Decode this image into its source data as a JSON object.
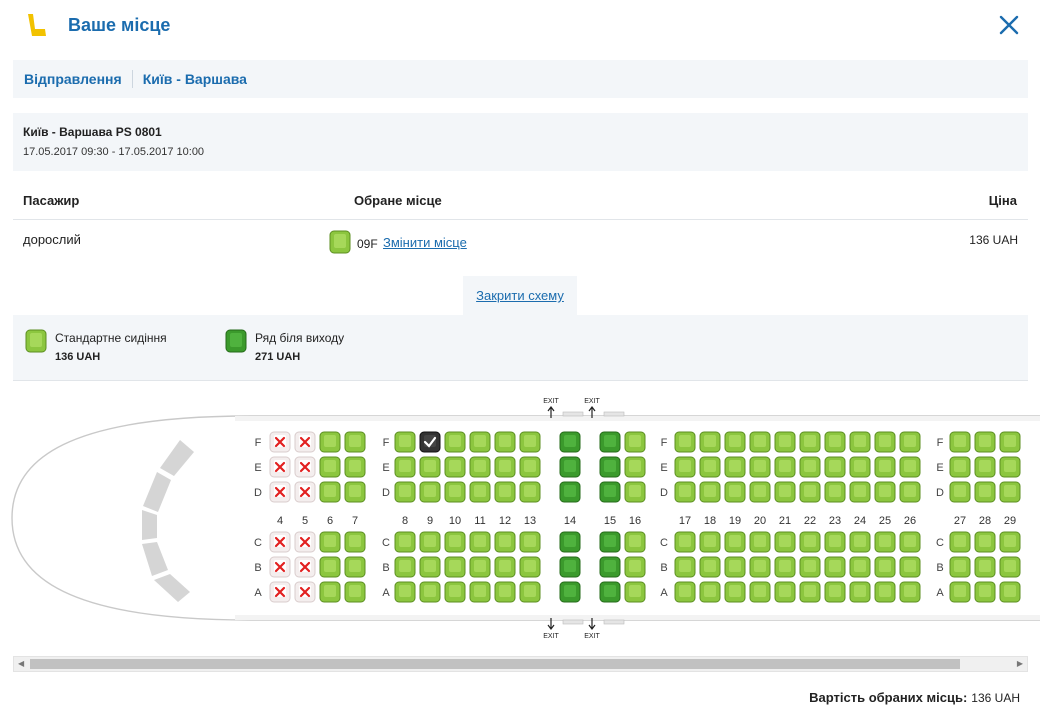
{
  "header": {
    "title": "Ваше місце"
  },
  "breadcrumb": {
    "step": "Відправлення",
    "route": "Київ - Варшава"
  },
  "flight": {
    "name": "Київ - Варшава PS 0801",
    "dates": "17.05.2017 09:30 - 17.05.2017 10:00"
  },
  "table": {
    "col_passenger": "Пасажир",
    "col_seat": "Обране місце",
    "col_price": "Ціна",
    "row": {
      "passenger": "дорослий",
      "seat": "09F",
      "change_label": "Змінити місце",
      "price": "136  UAH"
    }
  },
  "toggle": {
    "label": "Закрити схему"
  },
  "legend": [
    {
      "label": "Стандартне сидіння",
      "price": "136  UAH"
    },
    {
      "label": "Ряд біля виходу",
      "price": "271  UAH"
    }
  ],
  "seatmap": {
    "rows": [
      "4",
      "5",
      "6",
      "7",
      "8",
      "9",
      "10",
      "11",
      "12",
      "13",
      "14",
      "15",
      "16",
      "17",
      "18",
      "19",
      "20",
      "21",
      "22",
      "23",
      "24",
      "25",
      "26",
      "27",
      "28",
      "29"
    ],
    "letters_top": [
      "F",
      "E",
      "D"
    ],
    "letters_bottom": [
      "C",
      "B",
      "A"
    ],
    "exit_label": "EXIT",
    "occupied_rows": [
      "4",
      "5"
    ],
    "exit_rows": [
      "14",
      "15"
    ],
    "selected": {
      "row": "9",
      "letter": "F"
    },
    "colors": {
      "standard": "#8cc63f",
      "exit": "#3b9a2c",
      "occupied": "#f4eeee",
      "selected": "#333333",
      "x_mark": "#e22020"
    }
  },
  "total": {
    "label": "Вартість обраних місць:",
    "value": "136  UAH"
  }
}
